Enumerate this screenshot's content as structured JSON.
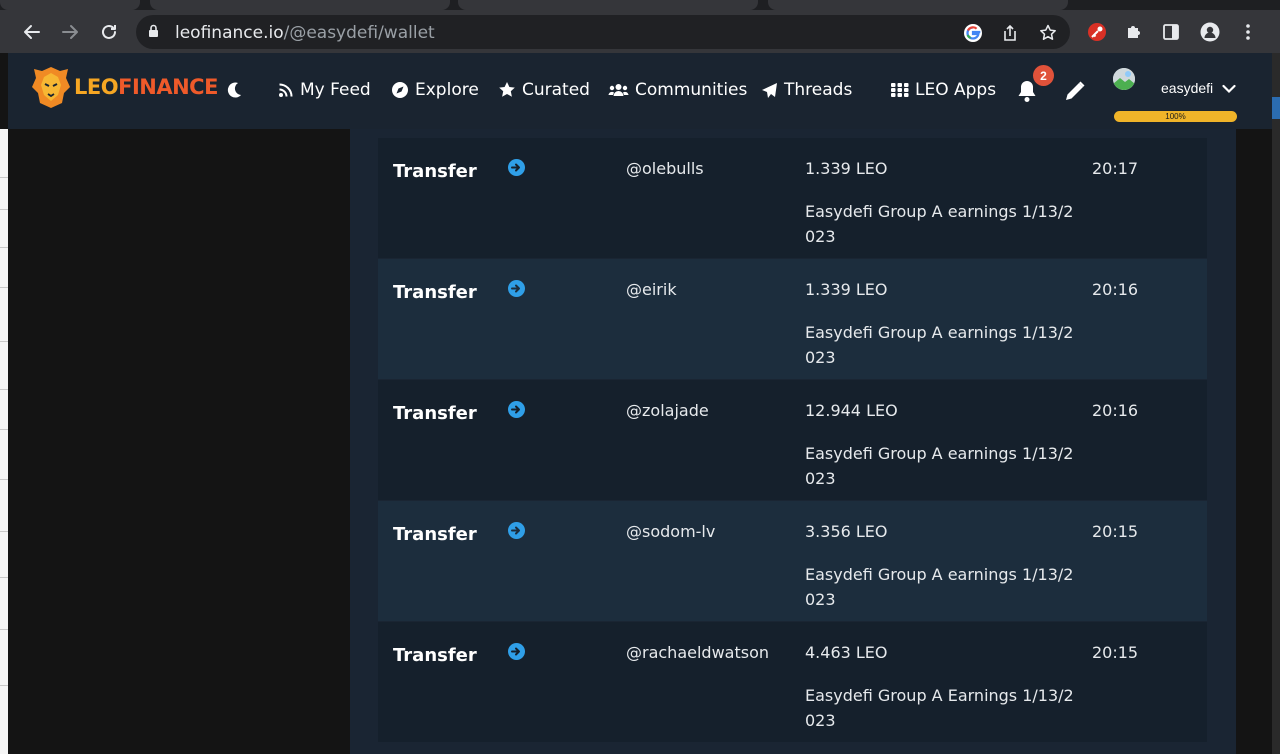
{
  "browser": {
    "url_host": "leofinance.io",
    "url_path": "/@easydefi/wallet"
  },
  "header": {
    "logo": {
      "part1": "LEO",
      "part2": "FINANCE"
    },
    "nav": [
      {
        "label": "My Feed",
        "icon": "rss-icon"
      },
      {
        "label": "Explore",
        "icon": "compass-icon"
      },
      {
        "label": "Curated",
        "icon": "star-icon"
      },
      {
        "label": "Communities",
        "icon": "users-icon"
      },
      {
        "label": "Threads",
        "icon": "paper-plane-icon"
      },
      {
        "label": "LEO Apps",
        "icon": "grid-icon"
      }
    ],
    "notifications_count": "2",
    "username": "easydefi",
    "resource_credits": "100%"
  },
  "transactions": [
    {
      "type": "Transfer",
      "direction_icon": "arrow-right-circle-icon",
      "user": "@olebulls",
      "amount": "1.339 LEO",
      "memo": "Easydefi Group A earnings 1/13/2023",
      "time": "20:17"
    },
    {
      "type": "Transfer",
      "direction_icon": "arrow-right-circle-icon",
      "user": "@eirik",
      "amount": "1.339 LEO",
      "memo": "Easydefi Group A earnings 1/13/2023",
      "time": "20:16"
    },
    {
      "type": "Transfer",
      "direction_icon": "arrow-right-circle-icon",
      "user": "@zolajade",
      "amount": "12.944 LEO",
      "memo": "Easydefi Group A earnings 1/13/2023",
      "time": "20:16"
    },
    {
      "type": "Transfer",
      "direction_icon": "arrow-right-circle-icon",
      "user": "@sodom-lv",
      "amount": "3.356 LEO",
      "memo": "Easydefi Group A earnings 1/13/2023",
      "time": "20:15"
    },
    {
      "type": "Transfer",
      "direction_icon": "arrow-right-circle-icon",
      "user": "@rachaeldwatson",
      "amount": "4.463 LEO",
      "memo": "Easydefi Group A Earnings 1/13/2023",
      "time": "20:15"
    }
  ],
  "colors": {
    "header_bg": "#1a2430",
    "row_dark": "#15202c",
    "row_light": "#1c2d3d",
    "accent_blue": "#2f9fe8",
    "badge": "#e0523a",
    "progress": "#f0b429"
  }
}
